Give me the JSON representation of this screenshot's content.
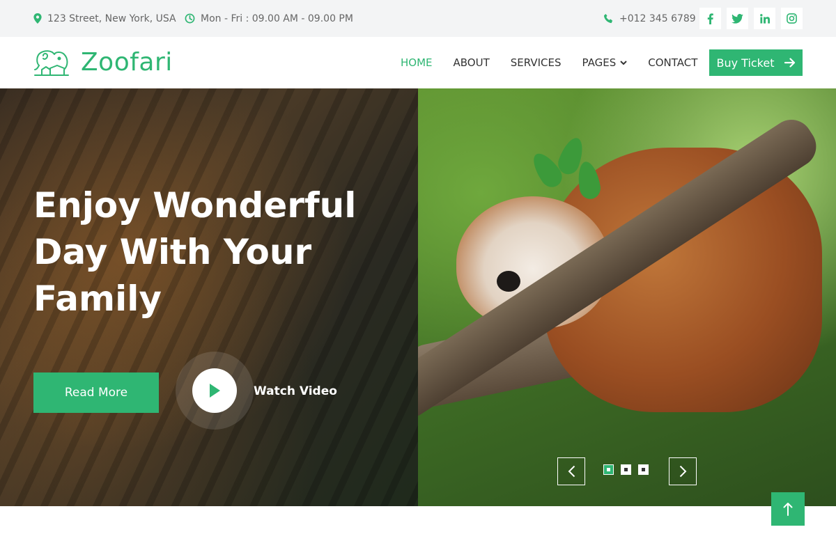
{
  "colors": {
    "accent": "#2fb673",
    "topbar_bg": "#f3f4f5",
    "nav_text": "#333333"
  },
  "topbar": {
    "address": "123 Street, New York, USA",
    "address_icon": "map-marker-icon",
    "hours": "Mon - Fri : 09.00 AM - 09.00 PM",
    "hours_icon": "clock-icon",
    "phone": "+012 345 6789",
    "phone_icon": "phone-icon",
    "socials": [
      "facebook-icon",
      "twitter-icon",
      "linkedin-icon",
      "instagram-icon"
    ]
  },
  "navbar": {
    "brand": "Zoofari",
    "brand_icon": "elephant-logo-icon",
    "links": [
      {
        "label": "HOME",
        "active": true
      },
      {
        "label": "ABOUT",
        "active": false
      },
      {
        "label": "SERVICES",
        "active": false
      },
      {
        "label": "PAGES",
        "active": false,
        "dropdown": true
      },
      {
        "label": "CONTACT",
        "active": false
      }
    ],
    "cta_label": "Buy Ticket",
    "cta_icon": "arrow-right-icon"
  },
  "hero": {
    "title": "Enjoy Wonderful Day With Your Family",
    "read_more_label": "Read More",
    "watch_label": "Watch Video",
    "play_icon": "play-icon",
    "carousel": {
      "slides": 3,
      "active_index": 0
    }
  },
  "back_to_top_icon": "arrow-up-icon"
}
